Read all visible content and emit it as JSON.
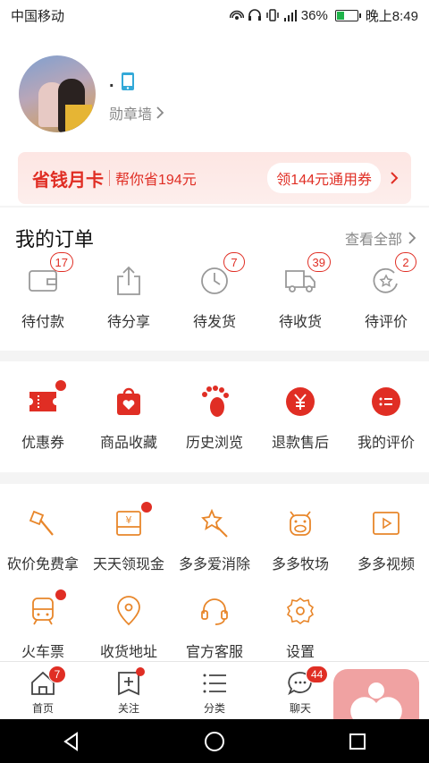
{
  "status_bar": {
    "carrier": "中国移动",
    "battery": "36%",
    "battery_level": 0.36,
    "time": "晚上8:49"
  },
  "profile": {
    "nickname": ".",
    "badge_wall": "勋章墙"
  },
  "savings_card": {
    "title": "省钱月卡",
    "subtitle": "帮你省194元",
    "coupon": "领144元通用券"
  },
  "orders": {
    "title": "我的订单",
    "view_all": "查看全部",
    "items": [
      {
        "label": "待付款",
        "count": "17",
        "icon": "wallet-icon"
      },
      {
        "label": "待分享",
        "count": "",
        "icon": "share-icon"
      },
      {
        "label": "待发货",
        "count": "7",
        "icon": "clock-icon"
      },
      {
        "label": "待收货",
        "count": "39",
        "icon": "truck-icon"
      },
      {
        "label": "待评价",
        "count": "2",
        "icon": "review-icon"
      }
    ]
  },
  "services": {
    "items": [
      {
        "label": "优惠券",
        "icon": "ticket-icon"
      },
      {
        "label": "商品收藏",
        "icon": "favorite-bag-icon"
      },
      {
        "label": "历史浏览",
        "icon": "footprint-icon"
      },
      {
        "label": "退款售后",
        "icon": "refund-icon"
      },
      {
        "label": "我的评价",
        "icon": "comment-icon"
      }
    ]
  },
  "tools": {
    "items": [
      {
        "label": "砍价免费拿",
        "icon": "axe-icon"
      },
      {
        "label": "天天领现金",
        "icon": "cash-envelope-icon"
      },
      {
        "label": "多多爱消除",
        "icon": "star-wand-icon"
      },
      {
        "label": "多多牧场",
        "icon": "cow-icon"
      },
      {
        "label": "多多视频",
        "icon": "video-icon"
      },
      {
        "label": "火车票",
        "icon": "train-icon"
      },
      {
        "label": "收货地址",
        "icon": "location-icon"
      },
      {
        "label": "官方客服",
        "icon": "headset-icon"
      },
      {
        "label": "设置",
        "icon": "settings-icon"
      }
    ]
  },
  "tabbar": {
    "items": [
      {
        "label": "首页",
        "badge": "7"
      },
      {
        "label": "关注",
        "badge": ""
      },
      {
        "label": "分类",
        "badge": ""
      },
      {
        "label": "聊天",
        "badge": "44"
      }
    ]
  },
  "colors": {
    "accent": "#e02e24",
    "icon_orange": "#e8862a",
    "icon_gray": "#999999"
  }
}
